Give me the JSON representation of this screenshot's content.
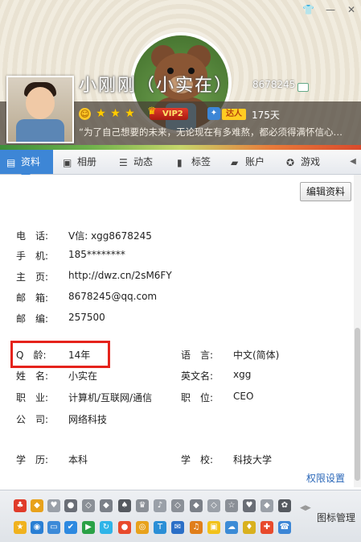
{
  "header": {
    "nickname": "小刚刚（小实在）",
    "qq_number": "8678245",
    "vip_label": "VIP2",
    "talent_label": "达人",
    "days": "175天",
    "signature": "“为了自己想要的未来，无论现在有多难熬，都必须得满怀信心…"
  },
  "tabs": [
    {
      "id": "profile",
      "label": "资料",
      "icon": "id-card-icon",
      "active": true
    },
    {
      "id": "album",
      "label": "相册",
      "icon": "album-icon",
      "active": false
    },
    {
      "id": "feed",
      "label": "动态",
      "icon": "list-icon",
      "active": false
    },
    {
      "id": "tags",
      "label": "标签",
      "icon": "bookmark-icon",
      "active": false
    },
    {
      "id": "account",
      "label": "账户",
      "icon": "wallet-icon",
      "active": false
    },
    {
      "id": "games",
      "label": "游戏",
      "icon": "gamepad-icon",
      "active": false
    }
  ],
  "actions": {
    "edit": "编辑资料",
    "permissions": "权限设置"
  },
  "profile": {
    "phone_label": "电　话:",
    "phone": "V信: xgg8678245",
    "mobile_label": "手　机:",
    "mobile": "185********",
    "homepage_label": "主　页:",
    "homepage": "http://dwz.cn/2sM6FY",
    "email_label": "邮　箱:",
    "email": "8678245@qq.com",
    "zip_label": "邮　编:",
    "zip": "257500",
    "age_label": "Q　龄:",
    "age": "14年",
    "language_label": "语　言:",
    "language": "中文(简体)",
    "name_label": "姓　名:",
    "name": "小实在",
    "en_name_label": "英文名:",
    "en_name": "xgg",
    "job_label": "职　业:",
    "job": "计算机/互联网/通信",
    "position_label": "职　位:",
    "position": "CEO",
    "company_label": "公　司:",
    "company": "网络科技",
    "education_label": "学　历:",
    "education": "本科",
    "school_label": "学　校:",
    "school": "科技大学"
  },
  "iconbar": {
    "manage": "图标管理"
  },
  "colors": {
    "accent": "#3d86d6",
    "highlight": "#e5231c",
    "link": "#2a67b8"
  }
}
